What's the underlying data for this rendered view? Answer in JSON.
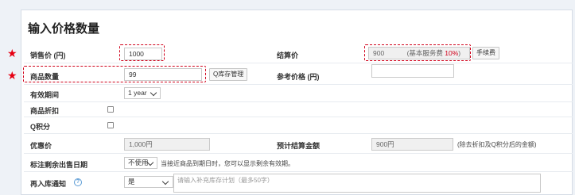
{
  "title": "输入价格数量",
  "required_mark": "★",
  "rows": {
    "sale_price": {
      "label": "销售价 (円)",
      "value": "1000"
    },
    "settle_price": {
      "label": "结算价",
      "value": "900",
      "note_prefix": "(基本服务费 ",
      "note_rate": "10%",
      "note_suffix": ")",
      "fee_button": "手续费"
    },
    "quantity": {
      "label": "商品数量",
      "value": "99",
      "stock_button": "Q库存管理"
    },
    "ref_price": {
      "label": "参考价格 (円)",
      "value": ""
    },
    "valid_period": {
      "label": "有效期间",
      "selected": "1 year"
    },
    "discount": {
      "label": "商品折扣"
    },
    "qpoint": {
      "label": "Q积分"
    },
    "special_price": {
      "label": "优惠价",
      "value": "1,000円"
    },
    "est_settle": {
      "label": "预计结算金额",
      "value": "900円",
      "note": "(除去折扣及Q积分后的金额)"
    },
    "expiry_mark": {
      "label": "标注剩余出售日期",
      "selected": "不使用",
      "note": "当接近商品到期日时，您可以显示剩余有效期。"
    },
    "restock": {
      "label": "再入库通知",
      "help": "?",
      "selected": "是",
      "placeholder": "请输入补充库存计划（最多50字）"
    }
  }
}
